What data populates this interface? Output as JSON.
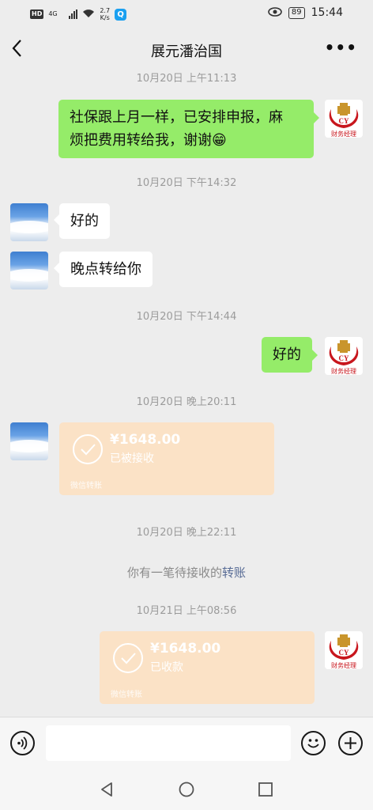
{
  "status_bar": {
    "hd": "HD",
    "network": "4G",
    "speed_value": "2.7",
    "speed_unit": "K/s",
    "app_badge": "Q",
    "battery": "89",
    "time": "15:44"
  },
  "header": {
    "title": "展元潘治国",
    "more_label": "•••"
  },
  "self_avatar": {
    "logo_text": "CY",
    "caption": "财务经理"
  },
  "messages": [
    {
      "type": "time",
      "text": "10月20日 上午11:13"
    },
    {
      "type": "text",
      "side": "right",
      "text_line1": "社保跟上月一样，已安排申报，麻",
      "text_line2": "烦把费用转给我，谢谢😁"
    },
    {
      "type": "time",
      "text": "10月20日 下午14:32"
    },
    {
      "type": "text",
      "side": "left",
      "text": "好的"
    },
    {
      "type": "text",
      "side": "left",
      "text": "晚点转给你"
    },
    {
      "type": "time",
      "text": "10月20日 下午14:44"
    },
    {
      "type": "text",
      "side": "right",
      "text": "好的"
    },
    {
      "type": "time",
      "text": "10月20日 晚上20:11"
    },
    {
      "type": "transfer",
      "side": "left",
      "amount": "¥1648.00",
      "status": "已被接收",
      "brand": "微信转账"
    },
    {
      "type": "time",
      "text": "10月20日 晚上22:11"
    },
    {
      "type": "system",
      "text": "你有一笔待接收的",
      "link": "转账"
    },
    {
      "type": "time",
      "text": "10月21日 上午08:56"
    },
    {
      "type": "transfer",
      "side": "right",
      "amount": "¥1648.00",
      "status": "已收款",
      "brand": "微信转账"
    }
  ],
  "input_bar": {
    "placeholder": ""
  },
  "colors": {
    "background": "#ededed",
    "bubble_green": "#95ec69",
    "bubble_white": "#ffffff",
    "transfer_bg": "#fbe2c6",
    "link": "#576b95",
    "logo_red": "#c8161d",
    "logo_gold": "#c9952c"
  }
}
